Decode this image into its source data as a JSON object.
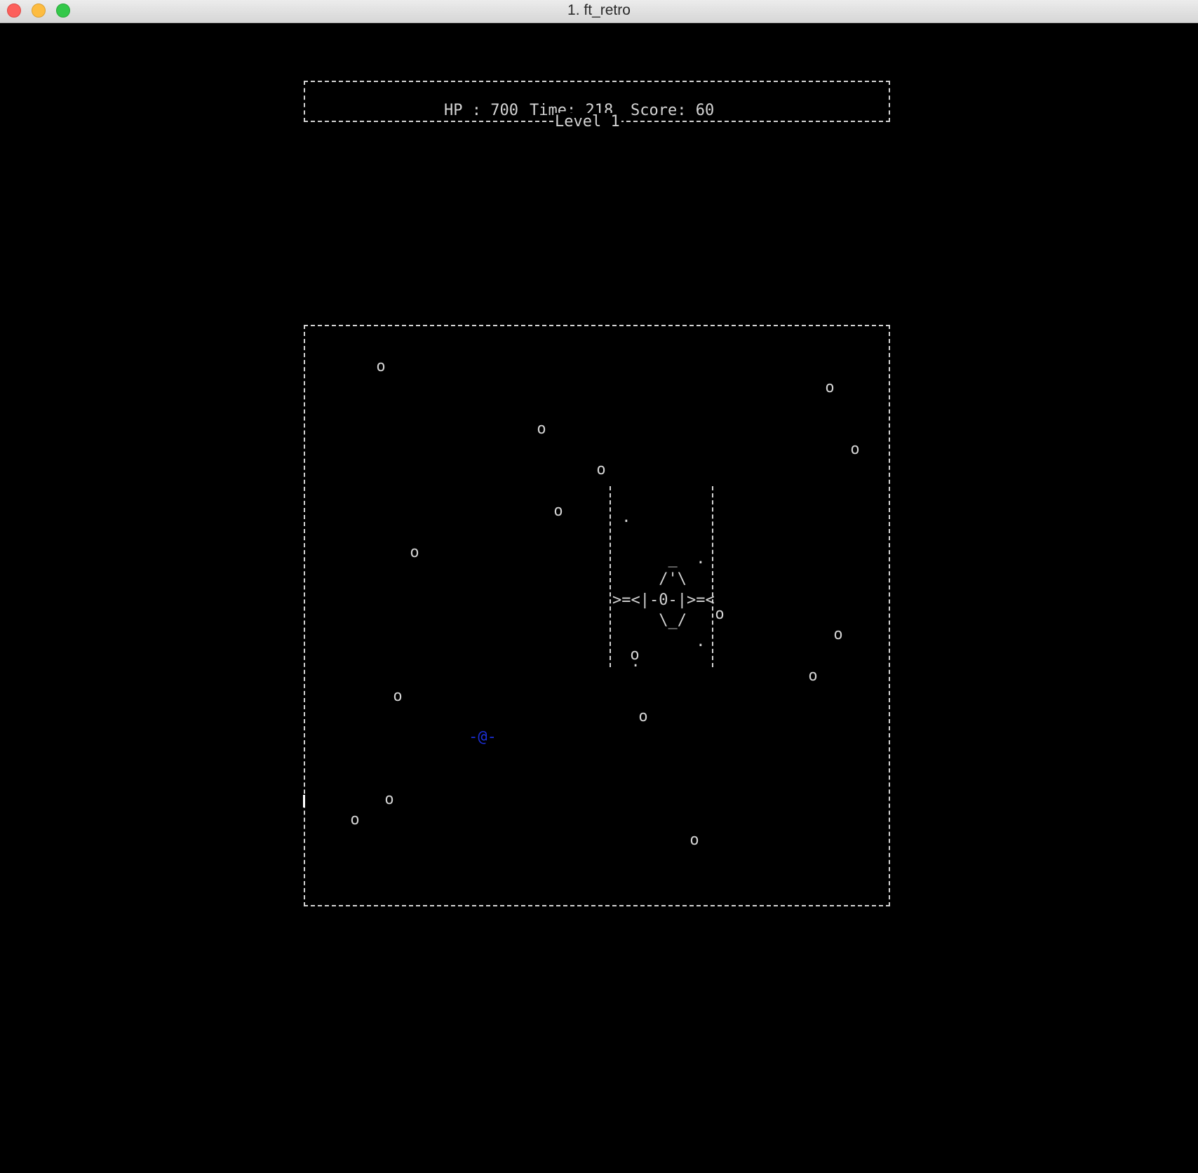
{
  "window": {
    "title": "1. ft_retro"
  },
  "hud": {
    "hp_text": "HP : 700",
    "time_text": "Time: 218",
    "score_text": "Score: 60",
    "level_text": "Level 1"
  },
  "game": {
    "player_glyph": "-@-",
    "obstacle_glyph": "o",
    "boss_art": "\n .\n\n      _  .\n     /'\\\n>=<|-0-|>=<\n     \\_/\n         .\n  .\n",
    "colors": {
      "background": "#000000",
      "text": "#d4d4d4",
      "player": "#1c2fd6"
    }
  }
}
